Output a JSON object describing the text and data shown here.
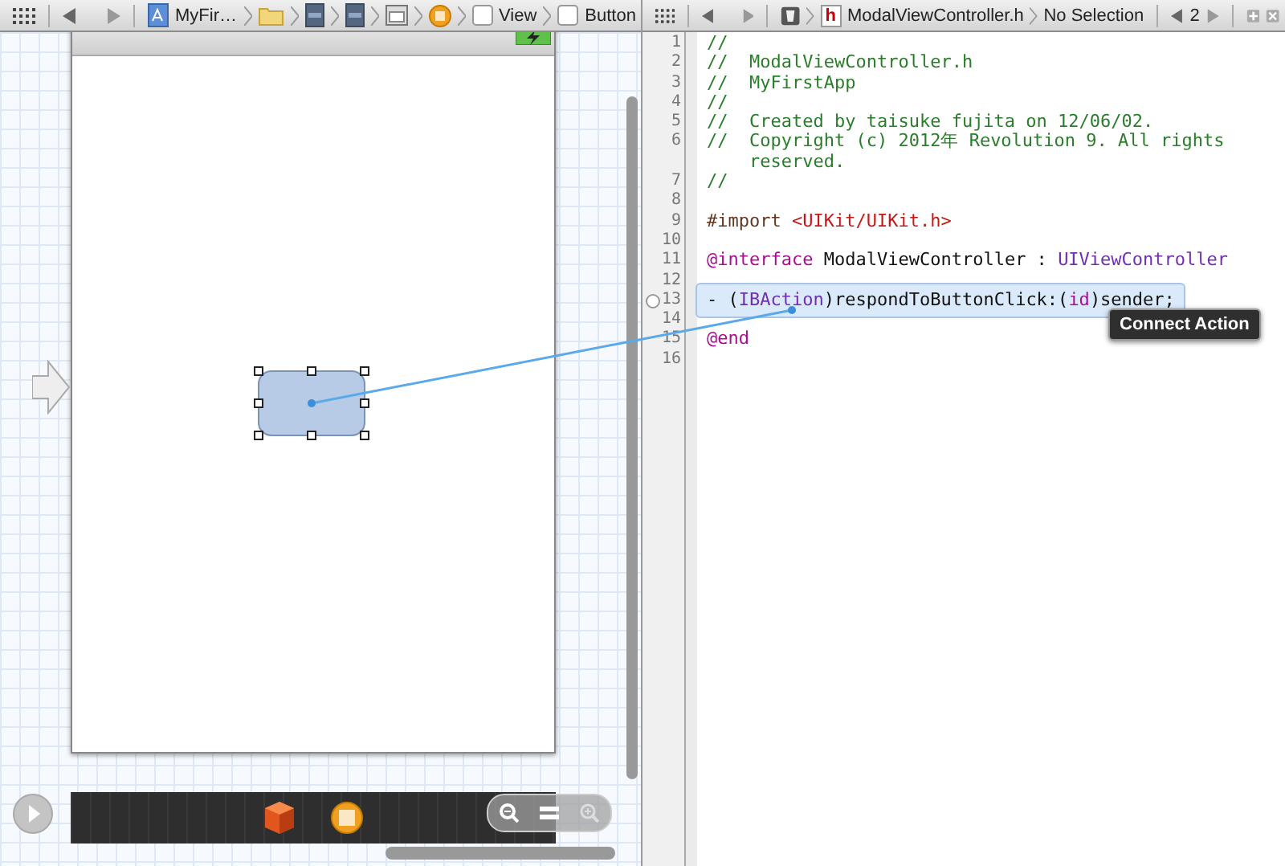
{
  "layout_pane": {
    "jump_bar": {
      "path": [
        {
          "kind": "project",
          "label": "MyFir…"
        },
        {
          "kind": "folder"
        },
        {
          "kind": "file"
        },
        {
          "kind": "file"
        },
        {
          "kind": "scene"
        },
        {
          "kind": "controller"
        },
        {
          "kind": "view",
          "label": "View"
        },
        {
          "kind": "view",
          "label": "Button"
        }
      ]
    }
  },
  "editor_pane": {
    "jump_bar": {
      "path": [
        {
          "kind": "bundle"
        },
        {
          "kind": "header",
          "badge": "h",
          "label": "ModalViewController.h"
        },
        {
          "kind": "text",
          "label": "No Selection"
        }
      ],
      "counterpart_count": "2"
    },
    "lines": [
      {
        "number": "1",
        "selected": false,
        "tokens": [
          {
            "kind": "comment",
            "text": "//"
          }
        ]
      },
      {
        "number": "2",
        "selected": false,
        "tokens": [
          {
            "kind": "comment",
            "text": "//  ModalViewController.h"
          }
        ]
      },
      {
        "number": "3",
        "selected": false,
        "tokens": [
          {
            "kind": "comment",
            "text": "//  MyFirstApp"
          }
        ]
      },
      {
        "number": "4",
        "selected": false,
        "tokens": [
          {
            "kind": "comment",
            "text": "//"
          }
        ]
      },
      {
        "number": "5",
        "selected": false,
        "tokens": [
          {
            "kind": "comment",
            "text": "//  Created by taisuke fujita on 12/06/02."
          }
        ]
      },
      {
        "number": "6",
        "selected": false,
        "tokens": [
          {
            "kind": "comment",
            "text": "//  Copyright (c) 2012年 Revolution 9. All rights reserved."
          }
        ]
      },
      {
        "number": "7",
        "selected": false,
        "tokens": [
          {
            "kind": "comment",
            "text": "//"
          }
        ]
      },
      {
        "number": "8",
        "selected": false
      },
      {
        "number": "9",
        "selected": false,
        "tokens": [
          {
            "kind": "directive",
            "text": "#import "
          },
          {
            "kind": "string",
            "text": "<UIKit/UIKit.h>"
          }
        ]
      },
      {
        "number": "10",
        "selected": false
      },
      {
        "number": "11",
        "selected": false,
        "tokens": [
          {
            "kind": "keyword",
            "text": "@interface"
          },
          {
            "kind": "plain",
            "text": " ModalViewController : "
          },
          {
            "kind": "type",
            "text": "UIViewController"
          }
        ]
      },
      {
        "number": "12",
        "selected": false
      },
      {
        "number": "13",
        "selected": true,
        "tokens": [
          {
            "kind": "plain",
            "text": "- ("
          },
          {
            "kind": "type",
            "text": "IBAction"
          },
          {
            "kind": "plain",
            "text": ")respondToButtonClick:("
          },
          {
            "kind": "keyword",
            "text": "id"
          },
          {
            "kind": "plain",
            "text": ")sender;"
          }
        ]
      },
      {
        "number": "14",
        "selected": false
      },
      {
        "number": "15",
        "selected": false,
        "tokens": [
          {
            "kind": "keyword",
            "text": "@end"
          }
        ]
      },
      {
        "number": "16",
        "selected": false
      }
    ],
    "tooltip": "Connect Action"
  }
}
